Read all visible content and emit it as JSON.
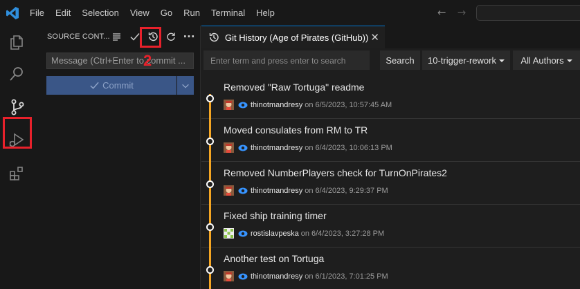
{
  "menu": [
    "File",
    "Edit",
    "Selection",
    "View",
    "Go",
    "Run",
    "Terminal",
    "Help"
  ],
  "annotations": {
    "one": "1",
    "two": "2"
  },
  "sidebar": {
    "header": "SOURCE CONT...",
    "message_placeholder": "Message (Ctrl+Enter to commit ...",
    "commit_label": "Commit"
  },
  "tab": {
    "title": "Git History (Age of Pirates (GitHub))",
    "close": "✕"
  },
  "toolbar": {
    "search_placeholder": "Enter term and press enter to search",
    "search_button": "Search",
    "branch": "10-trigger-rework",
    "authors": "All Authors"
  },
  "commits": [
    {
      "subject": "Removed \"Raw Tortuga\" readme",
      "author": "thinotmandresy",
      "date": "on 6/5/2023, 10:57:45 AM",
      "avatar": "pirate"
    },
    {
      "subject": "Moved consulates from RM to TR",
      "author": "thinotmandresy",
      "date": "on 6/4/2023, 10:06:13 PM",
      "avatar": "pirate"
    },
    {
      "subject": "Removed NumberPlayers check for TurnOnPirates2",
      "author": "thinotmandresy",
      "date": "on 6/4/2023, 9:29:37 PM",
      "avatar": "pirate"
    },
    {
      "subject": "Fixed ship training timer",
      "author": "rostislavpeska",
      "date": "on 6/4/2023, 3:27:28 PM",
      "avatar": "identicon"
    },
    {
      "subject": "Another test on Tortuga",
      "author": "thinotmandresy",
      "date": "on 6/1/2023, 7:01:25 PM",
      "avatar": "pirate"
    }
  ],
  "colors": {
    "accent": "#0078d4",
    "graph": "#f5a623",
    "highlight": "#e8212b",
    "commit_button": "#3a5687"
  }
}
